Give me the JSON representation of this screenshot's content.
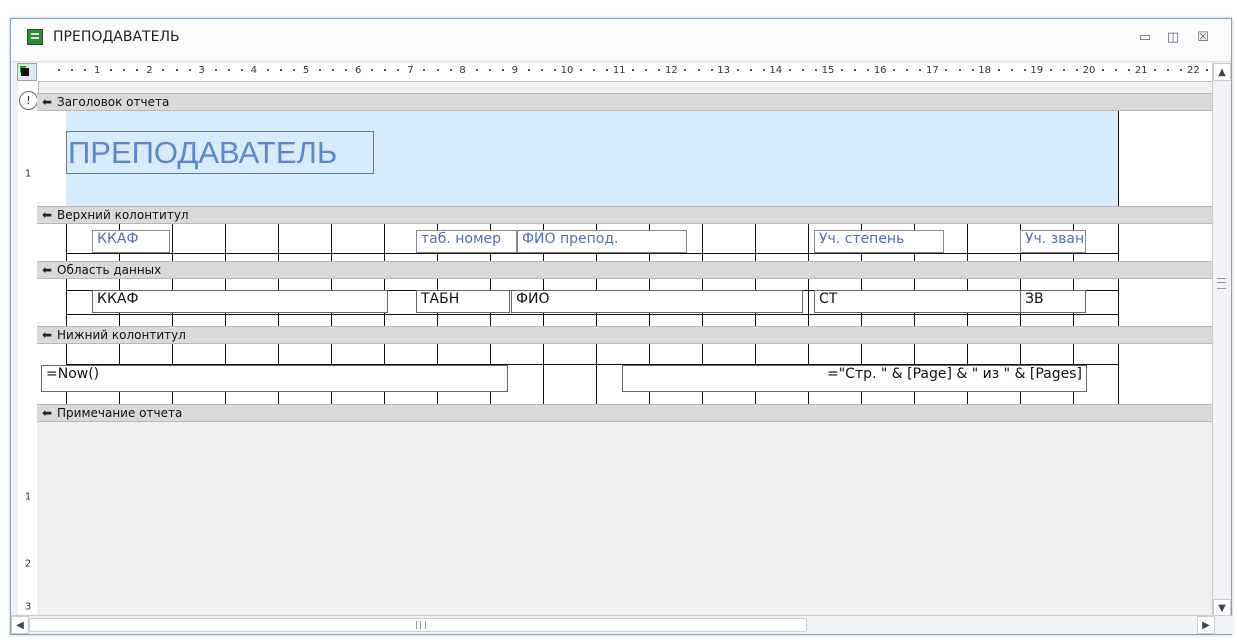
{
  "window": {
    "title": "ПРЕПОДАВАТЕЛЬ",
    "controls": [
      "minimize",
      "maximize",
      "close"
    ]
  },
  "ruler": {
    "numbers": [
      "1",
      "2",
      "3",
      "4",
      "5",
      "6",
      "7",
      "8",
      "9",
      "10",
      "11",
      "12",
      "13",
      "14",
      "15",
      "16",
      "17",
      "18",
      "19",
      "20",
      "21",
      "22"
    ]
  },
  "vertical_ruler": {
    "marks": [
      "1",
      "1",
      "2",
      "3"
    ]
  },
  "sections": [
    {
      "name": "report-header",
      "label": "Заголовок отчета"
    },
    {
      "name": "page-header",
      "label": "Верхний колонтитул"
    },
    {
      "name": "detail",
      "label": "Область данных"
    },
    {
      "name": "page-footer",
      "label": "Нижний колонтитул"
    },
    {
      "name": "report-footer",
      "label": "Примечание отчета"
    }
  ],
  "report_header": {
    "title_label": "ПРЕПОДАВАТЕЛЬ"
  },
  "page_header": {
    "labels": [
      "ККАФ",
      "таб. номер",
      "ФИО препод.",
      "Уч. степень",
      "Уч. зван"
    ]
  },
  "detail": {
    "fields": [
      "ККАФ",
      "ТАБН",
      "ФИО",
      "СТ",
      "ЗВ"
    ]
  },
  "page_footer": {
    "left_expr": "=Now()",
    "right_expr": "=\"Стр. \" & [Page] & \" из \" & [Pages]"
  },
  "colors": {
    "selection_fill": "#d8ebfa",
    "grid": "#111111",
    "label_text": "#4f6eb3"
  },
  "icons": [
    "report-icon",
    "warning-icon",
    "scroll-up-icon",
    "scroll-down-icon",
    "scroll-left-icon",
    "scroll-right-icon"
  ]
}
